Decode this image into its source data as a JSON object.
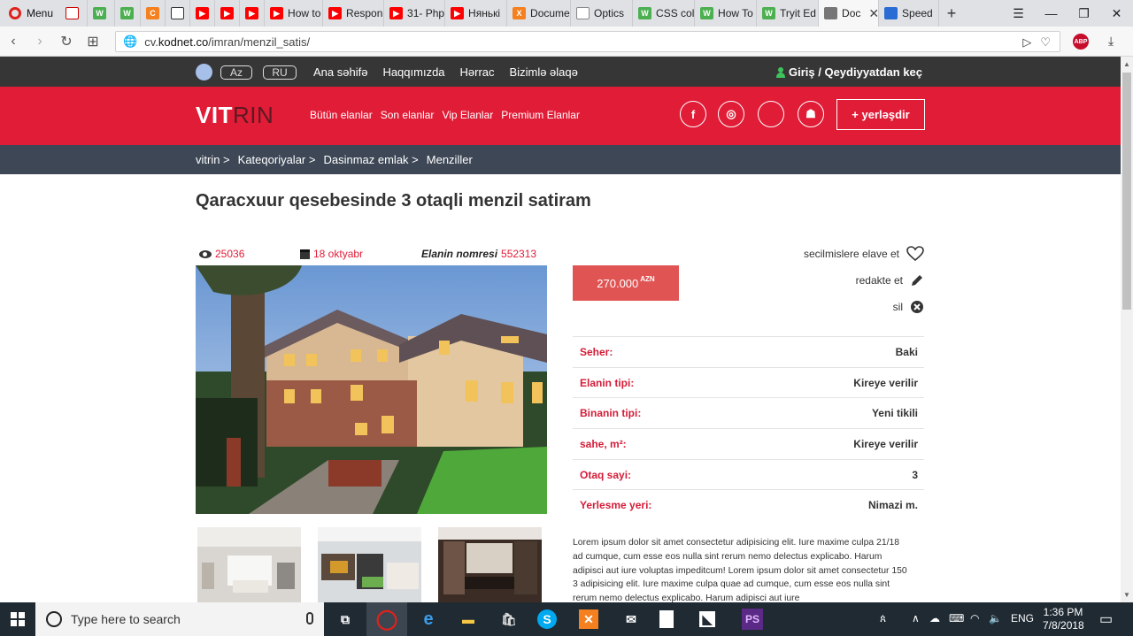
{
  "browser": {
    "menu_label": "Menu",
    "tabs": [
      {
        "label": "",
        "icon": "red-logo-icon"
      },
      {
        "label": "",
        "icon": "green-w-icon"
      },
      {
        "label": "",
        "icon": "green-w-icon"
      },
      {
        "label": "",
        "icon": "orange-c-icon"
      },
      {
        "label": "",
        "icon": "codepen-icon"
      },
      {
        "label": "",
        "icon": "youtube-icon"
      },
      {
        "label": "",
        "icon": "youtube-icon"
      },
      {
        "label": "",
        "icon": "youtube-icon"
      },
      {
        "label": "How to",
        "icon": "youtube-icon"
      },
      {
        "label": "Respon",
        "icon": "youtube-icon"
      },
      {
        "label": "31- Php",
        "icon": "youtube-icon"
      },
      {
        "label": "Нянькі",
        "icon": "youtube-icon"
      },
      {
        "label": "Docume",
        "icon": "xampp-icon"
      },
      {
        "label": "Optics",
        "icon": "document-icon"
      },
      {
        "label": "CSS col",
        "icon": "green-w-icon"
      },
      {
        "label": "How To",
        "icon": "green-w-icon"
      },
      {
        "label": "Tryit Ed",
        "icon": "green-w-icon"
      },
      {
        "label": "Doc",
        "icon": "fingerprint-icon"
      },
      {
        "label": "Speed",
        "icon": "grid-icon"
      }
    ],
    "url_prefix": "cv.",
    "url_host": "kodnet.co",
    "url_path": "/imran/menzil_satis/",
    "abp_label": "ABP"
  },
  "topbar": {
    "lang_az": "Az",
    "lang_ru": "RU",
    "nav": [
      "Ana səhifə",
      "Haqqımızda",
      "Hərrac",
      "Bizimlə əlaqə"
    ],
    "login": "Giriş / Qeydiyyatdan keç"
  },
  "header": {
    "logo_a": "VIT",
    "logo_b": "RIN",
    "nav": [
      "Bütün elanlar",
      "Son elanlar",
      "Vip Elanlar",
      "Premium Elanlar"
    ],
    "social": [
      "facebook-icon",
      "instagram-icon",
      "apple-icon",
      "android-icon"
    ],
    "post_button": "+ yerləşdir"
  },
  "breadcrumb": [
    "vitrin >",
    "Kateqoriyalar >",
    "Dasinmaz emlak >",
    "Menziller"
  ],
  "listing": {
    "title": "Qaracxuur qesebesinde 3 otaqli menzil satiram",
    "views": "25036",
    "date": "18 oktyabr",
    "number_label": "Elanin nomresi",
    "number": "552313",
    "price": "270.000",
    "currency": "AZN",
    "actions": {
      "favorite": "secilmislere elave et",
      "edit": "redakte et",
      "delete": "sil"
    },
    "details": [
      {
        "key": "Seher:",
        "value": "Baki"
      },
      {
        "key": "Elanin tipi:",
        "value": "Kireye verilir"
      },
      {
        "key": "Binanin tipi:",
        "value": "Yeni tikili"
      },
      {
        "key": "sahe, m²:",
        "value": "Kireye verilir"
      },
      {
        "key": "Otaq sayi:",
        "value": "3"
      },
      {
        "key": "Yerlesme yeri:",
        "value": "Nimazi m."
      }
    ],
    "description": "Lorem ipsum dolor sit amet consectetur adipisicing elit. Iure maxime culpa 21/18 ad cumque, cum esse eos nulla sint rerum nemo delectus explicabo. Harum adipisci aut iure voluptas impeditcum! Lorem ipsum dolor sit amet consectetur 150 3 adipisicing elit. Iure maxime culpa quae ad cumque, cum esse eos nulla sint rerum nemo delectus explicabo. Harum adipisci aut iure"
  },
  "taskbar": {
    "search_placeholder": "Type here to search",
    "lang": "ENG",
    "time": "1:36 PM",
    "date": "7/8/2018"
  },
  "colors": {
    "brand_red": "#e11c37",
    "top_dark": "#363636",
    "crumb_bar": "#3d4756",
    "price_bg": "#e05454"
  }
}
